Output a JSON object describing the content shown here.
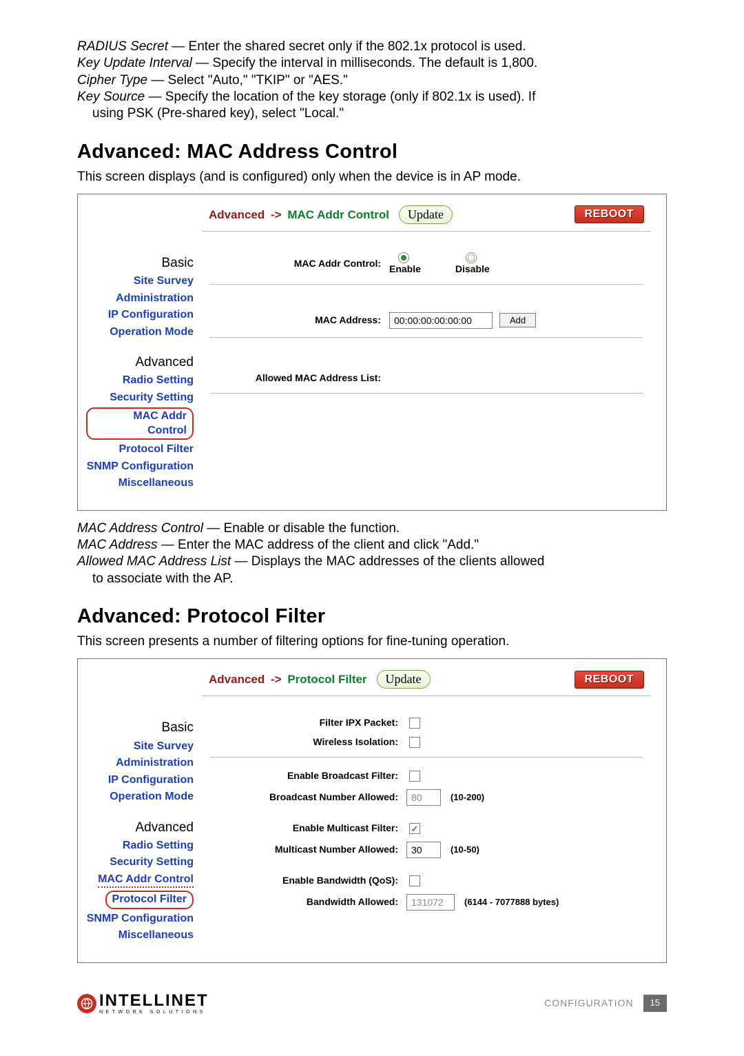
{
  "intro": {
    "l1_term": "RADIUS Secret",
    "l1_text": " — Enter the shared secret only if the 802.1x protocol is used.",
    "l2_term": "Key Update Interval",
    "l2_text": " — Specify the interval in milliseconds. The default is 1,800.",
    "l3_term": "Cipher Type",
    "l3_text": " — Select \"Auto,\" \"TKIP\" or \"AES.\"",
    "l4_term": "Key Source",
    "l4_text": " — Specify the location of the key storage (only if 802.1x is used). If",
    "l4_cont": "using PSK (Pre-shared key), select \"Local.\""
  },
  "sec1": {
    "heading": "Advanced: MAC Address Control",
    "desc": "This screen displays (and is configured) only when the device is in AP mode.",
    "breadcrumb_root": "Advanced",
    "breadcrumb_arrow": "->",
    "breadcrumb_leaf": "MAC Addr Control",
    "update": "Update",
    "reboot": "REBOOT",
    "lbl_mac_ctrl": "MAC Addr Control:",
    "opt_enable": "Enable",
    "opt_disable": "Disable",
    "lbl_mac_addr": "MAC Address:",
    "mac_value": "00:00:00:00:00:00",
    "add_btn": "Add",
    "lbl_allowed": "Allowed MAC Address List:",
    "post": {
      "l1_term": "MAC Address Control",
      "l1_text": " — Enable or disable the function.",
      "l2_term": "MAC Address",
      "l2_text": " — Enter the MAC address of the client and click \"Add.\"",
      "l3_term": "Allowed MAC Address List",
      "l3_text": " — Displays the MAC addresses of the clients allowed",
      "l3_cont": "to associate with the AP."
    }
  },
  "nav": {
    "basic": "Basic",
    "site_survey": "Site Survey",
    "administration": "Administration",
    "ip_config": "IP Configuration",
    "op_mode": "Operation Mode",
    "advanced": "Advanced",
    "radio": "Radio Setting",
    "security": "Security Setting",
    "mac_addr": "MAC Addr Control",
    "protocol": "Protocol Filter",
    "snmp": "SNMP Configuration",
    "misc": "Miscellaneous"
  },
  "sec2": {
    "heading": "Advanced: Protocol Filter",
    "desc": "This screen presents a number of filtering options for fine-tuning operation.",
    "breadcrumb_root": "Advanced",
    "breadcrumb_arrow": "->",
    "breadcrumb_leaf": "Protocol Filter",
    "update": "Update",
    "reboot": "REBOOT",
    "lbl_ipx": "Filter IPX Packet:",
    "lbl_wireless": "Wireless Isolation:",
    "lbl_bcast_en": "Enable Broadcast Filter:",
    "lbl_bcast_num": "Broadcast Number Allowed:",
    "bcast_num_val": "80",
    "bcast_range": "(10-200)",
    "lbl_mcast_en": "Enable Multicast Filter:",
    "lbl_mcast_num": "Multicast Number Allowed:",
    "mcast_num_val": "30",
    "mcast_range": "(10-50)",
    "lbl_qos": "Enable Bandwidth (QoS):",
    "lbl_bw": "Bandwidth Allowed:",
    "bw_val": "131072",
    "bw_range": "(6144 - 7077888 bytes)"
  },
  "footer": {
    "brand": "INTELLINET",
    "brand_sub": "NETWORK SOLUTIONS",
    "config": "CONFIGURATION",
    "page": "15"
  }
}
